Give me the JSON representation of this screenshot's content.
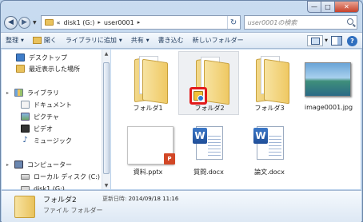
{
  "window": {
    "minimize_glyph": "—",
    "maximize_glyph": "□",
    "close_glyph": "✕"
  },
  "nav": {
    "back_glyph": "◀",
    "forward_glyph": "▶",
    "history_glyph": "▼",
    "breadcrumb": [
      {
        "text": "«"
      },
      {
        "text": "disk1 (G:)"
      },
      {
        "text": "user0001"
      }
    ],
    "breadcrumb_sep": "▸",
    "refresh_glyph": "↻",
    "search_placeholder": "user0001の検索"
  },
  "toolbar": {
    "organize": "整理",
    "open": "開く",
    "add_to_library": "ライブラリに追加",
    "share": "共有",
    "burn": "書き込む",
    "new_folder": "新しいフォルダー",
    "help_glyph": "?",
    "dropdown_glyph": "▼"
  },
  "sidebar": {
    "items": [
      {
        "label": "デスクトップ",
        "icon": "desktop-icon"
      },
      {
        "label": "最近表示した場所",
        "icon": "recent-places-icon"
      },
      {
        "label": "ライブラリ",
        "icon": "library-icon"
      },
      {
        "label": "ドキュメント",
        "icon": "documents-icon"
      },
      {
        "label": "ピクチャ",
        "icon": "pictures-icon"
      },
      {
        "label": "ビデオ",
        "icon": "videos-icon"
      },
      {
        "label": "ミュージック",
        "icon": "music-icon"
      },
      {
        "label": "コンピューター",
        "icon": "computer-icon"
      },
      {
        "label": "ローカル ディスク (C:)",
        "icon": "local-disk-icon"
      },
      {
        "label": "disk1 (G:)",
        "icon": "usb-drive-icon"
      }
    ],
    "music_glyph": "♪",
    "expand_glyph": "▸",
    "scroll_up": "▲",
    "scroll_down": "▼"
  },
  "files": [
    {
      "name": "フォルダ1",
      "type": "folder"
    },
    {
      "name": "フォルダ2",
      "type": "folder",
      "selected": true,
      "overlay": "shortcut-overlay-icon"
    },
    {
      "name": "フォルダ3",
      "type": "folder"
    },
    {
      "name": "image0001.jpg",
      "type": "image"
    },
    {
      "name": "資料.pptx",
      "type": "pptx",
      "badge": "P"
    },
    {
      "name": "質問.docx",
      "type": "docx",
      "badge": "W"
    },
    {
      "name": "論文.docx",
      "type": "docx",
      "badge": "W"
    }
  ],
  "details": {
    "name": "フォルダ2",
    "type": "ファイル フォルダー",
    "modified_label": "更新日時:",
    "modified_value": "2014/09/18 11:16"
  },
  "colors": {
    "selection_highlight": "#e21a1a",
    "folder": "#e9c25c",
    "word": "#2b5fb4",
    "powerpoint": "#d24726"
  }
}
